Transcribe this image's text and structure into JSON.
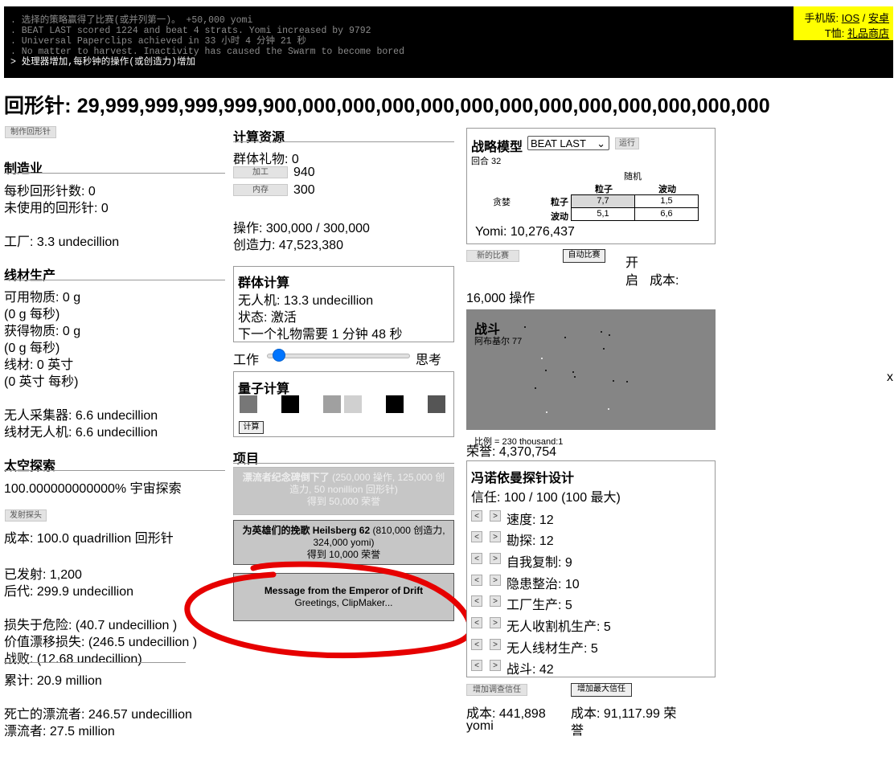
{
  "console": {
    "lines": [
      ". 选择的策略赢得了比赛(或并列第一)。 +50,000 yomi",
      ". BEAT LAST scored 1224 and beat 4 strats. Yomi increased by 9792",
      ". Universal Paperclips achieved in 33 小时 4 分钟 21 秒",
      ". No matter to harvest. Inactivity has caused the Swarm to become bored",
      "> 处理器增加,每秒钟的操作(或创造力)增加"
    ]
  },
  "mobile": {
    "label1": "手机版: ",
    "ios": "IOS",
    "sep": " / ",
    "android": "安卓",
    "label2": "T恤: ",
    "shop": "礼品商店"
  },
  "clips": "回形针: 29,999,999,999,999,900,000,000,000,000,000,000,000,000,000,000,000,000",
  "left": {
    "make_btn": "制作回形针",
    "mfg_hdr": "制造业",
    "clips_per_sec": "每秒回形针数: 0",
    "unused": "未使用的回形针: 0",
    "factories": "工厂: 3.3 undecillion",
    "wire_hdr": "线材生产",
    "avail": "可用物质: 0 g",
    "avail_rate": "(0 g 每秒)",
    "acquired": "获得物质: 0 g",
    "acquired_rate": "(0 g 每秒)",
    "wire": "线材: 0 英寸",
    "wire_rate": "(0 英寸 每秒)",
    "harvesters": "无人采集器: 6.6 undecillion",
    "wiredrones": "线材无人机: 6.6 undecillion",
    "space_hdr": "太空探索",
    "explored": "100.000000000000% 宇宙探索",
    "launch_btn": "发射探头",
    "cost": "成本: 100.0 quadrillion 回形针",
    "launched": "已发射: 1,200",
    "descendants": "后代: 299.9 undecillion",
    "hazards": "损失于危险: (40.7 undecillion )",
    "drift": "价值漂移损失: (246.5 undecillion )",
    "combat": "战败: (12.68 undecillion)",
    "total": "累计: 20.9 million",
    "dead_drifters": "死亡的漂流者: 246.57 undecillion",
    "drifters": "漂流者: 27.5 million"
  },
  "mid": {
    "compute_hdr": "计算资源",
    "swarm_gifts": "群体礼物: 0",
    "proc_btn": "加工",
    "proc_val": "940",
    "mem_btn": "内存",
    "mem_val": "300",
    "ops": "操作: 300,000 / 300,000",
    "creativity": "创造力: 47,523,380",
    "swarm_hdr": "群体计算",
    "drones": "无人机: 13.3 undecillion",
    "status": "状态: 激活",
    "next_gift": "下一个礼物需要 1 分钟 48 秒",
    "work": "工作",
    "think": "思考",
    "slider_value": 0.04,
    "quantum_hdr": "量子计算",
    "quantum_chips": [
      "#777777",
      "#000000",
      "#a0a0a0",
      "#d0d0d0",
      "#000000",
      "#555555"
    ],
    "compute_btn": "计算",
    "projects_hdr": "项目",
    "p1_title": "漂流者纪念碑倒下了",
    "p1_cost": "(250,000 操作, 125,000 创造力, 50 nonillion 回形针)",
    "p1_reward": "得到 50,000 荣誉",
    "p2_title": "为英雄们的挽歌 Heilsberg 62",
    "p2_cost": "(810,000 创造力, 324,000 yomi)",
    "p2_reward": "得到 10,000 荣誉",
    "p3_title": "Message from the Emperor of Drift",
    "p3_sub": "Greetings, ClipMaker..."
  },
  "right": {
    "strat_hdr": "战略模型",
    "strat_select": "BEAT LAST",
    "run_btn": "运行",
    "round": "回合 32",
    "random": "随机",
    "col1": "粒子",
    "col2": "波动",
    "greedy": "贪婪",
    "row1": "粒子",
    "row2": "波动",
    "cells": [
      "7,7",
      "1,5",
      "5,1",
      "6,6"
    ],
    "yomi": "Yomi: 10,276,437",
    "new_tourney_btn": "新的比赛",
    "auto_tourney_btn": "自动比赛",
    "on1": "开",
    "on2": "启",
    "cost_label": "成本:",
    "cost_ops": "16,000 操作",
    "battle_hdr": "战斗",
    "battle_name": "阿布基尔 77",
    "ratio": "比例 = 230 thousand:1",
    "honor": "荣誉: 4,370,754",
    "probe_hdr": "冯诺依曼探针设计",
    "trust": "信任: 100 / 100 (100 最大)",
    "stats": [
      {
        "label": "速度: 12"
      },
      {
        "label": "勘探: 12"
      },
      {
        "label": "自我复制: 9"
      },
      {
        "label": "隐患整治: 10"
      },
      {
        "label": "工厂生产: 5"
      },
      {
        "label": "无人收割机生产: 5"
      },
      {
        "label": "无人线材生产: 5"
      },
      {
        "label": "战斗: 42"
      }
    ],
    "inc_trust_btn": "增加调查信任",
    "inc_max_btn": "增加最大信任",
    "cost1a": "成本: 441,898",
    "cost1b": "yomi",
    "cost2a": "成本: 91,117.99 荣",
    "cost2b": "誉"
  },
  "close_x": "x"
}
